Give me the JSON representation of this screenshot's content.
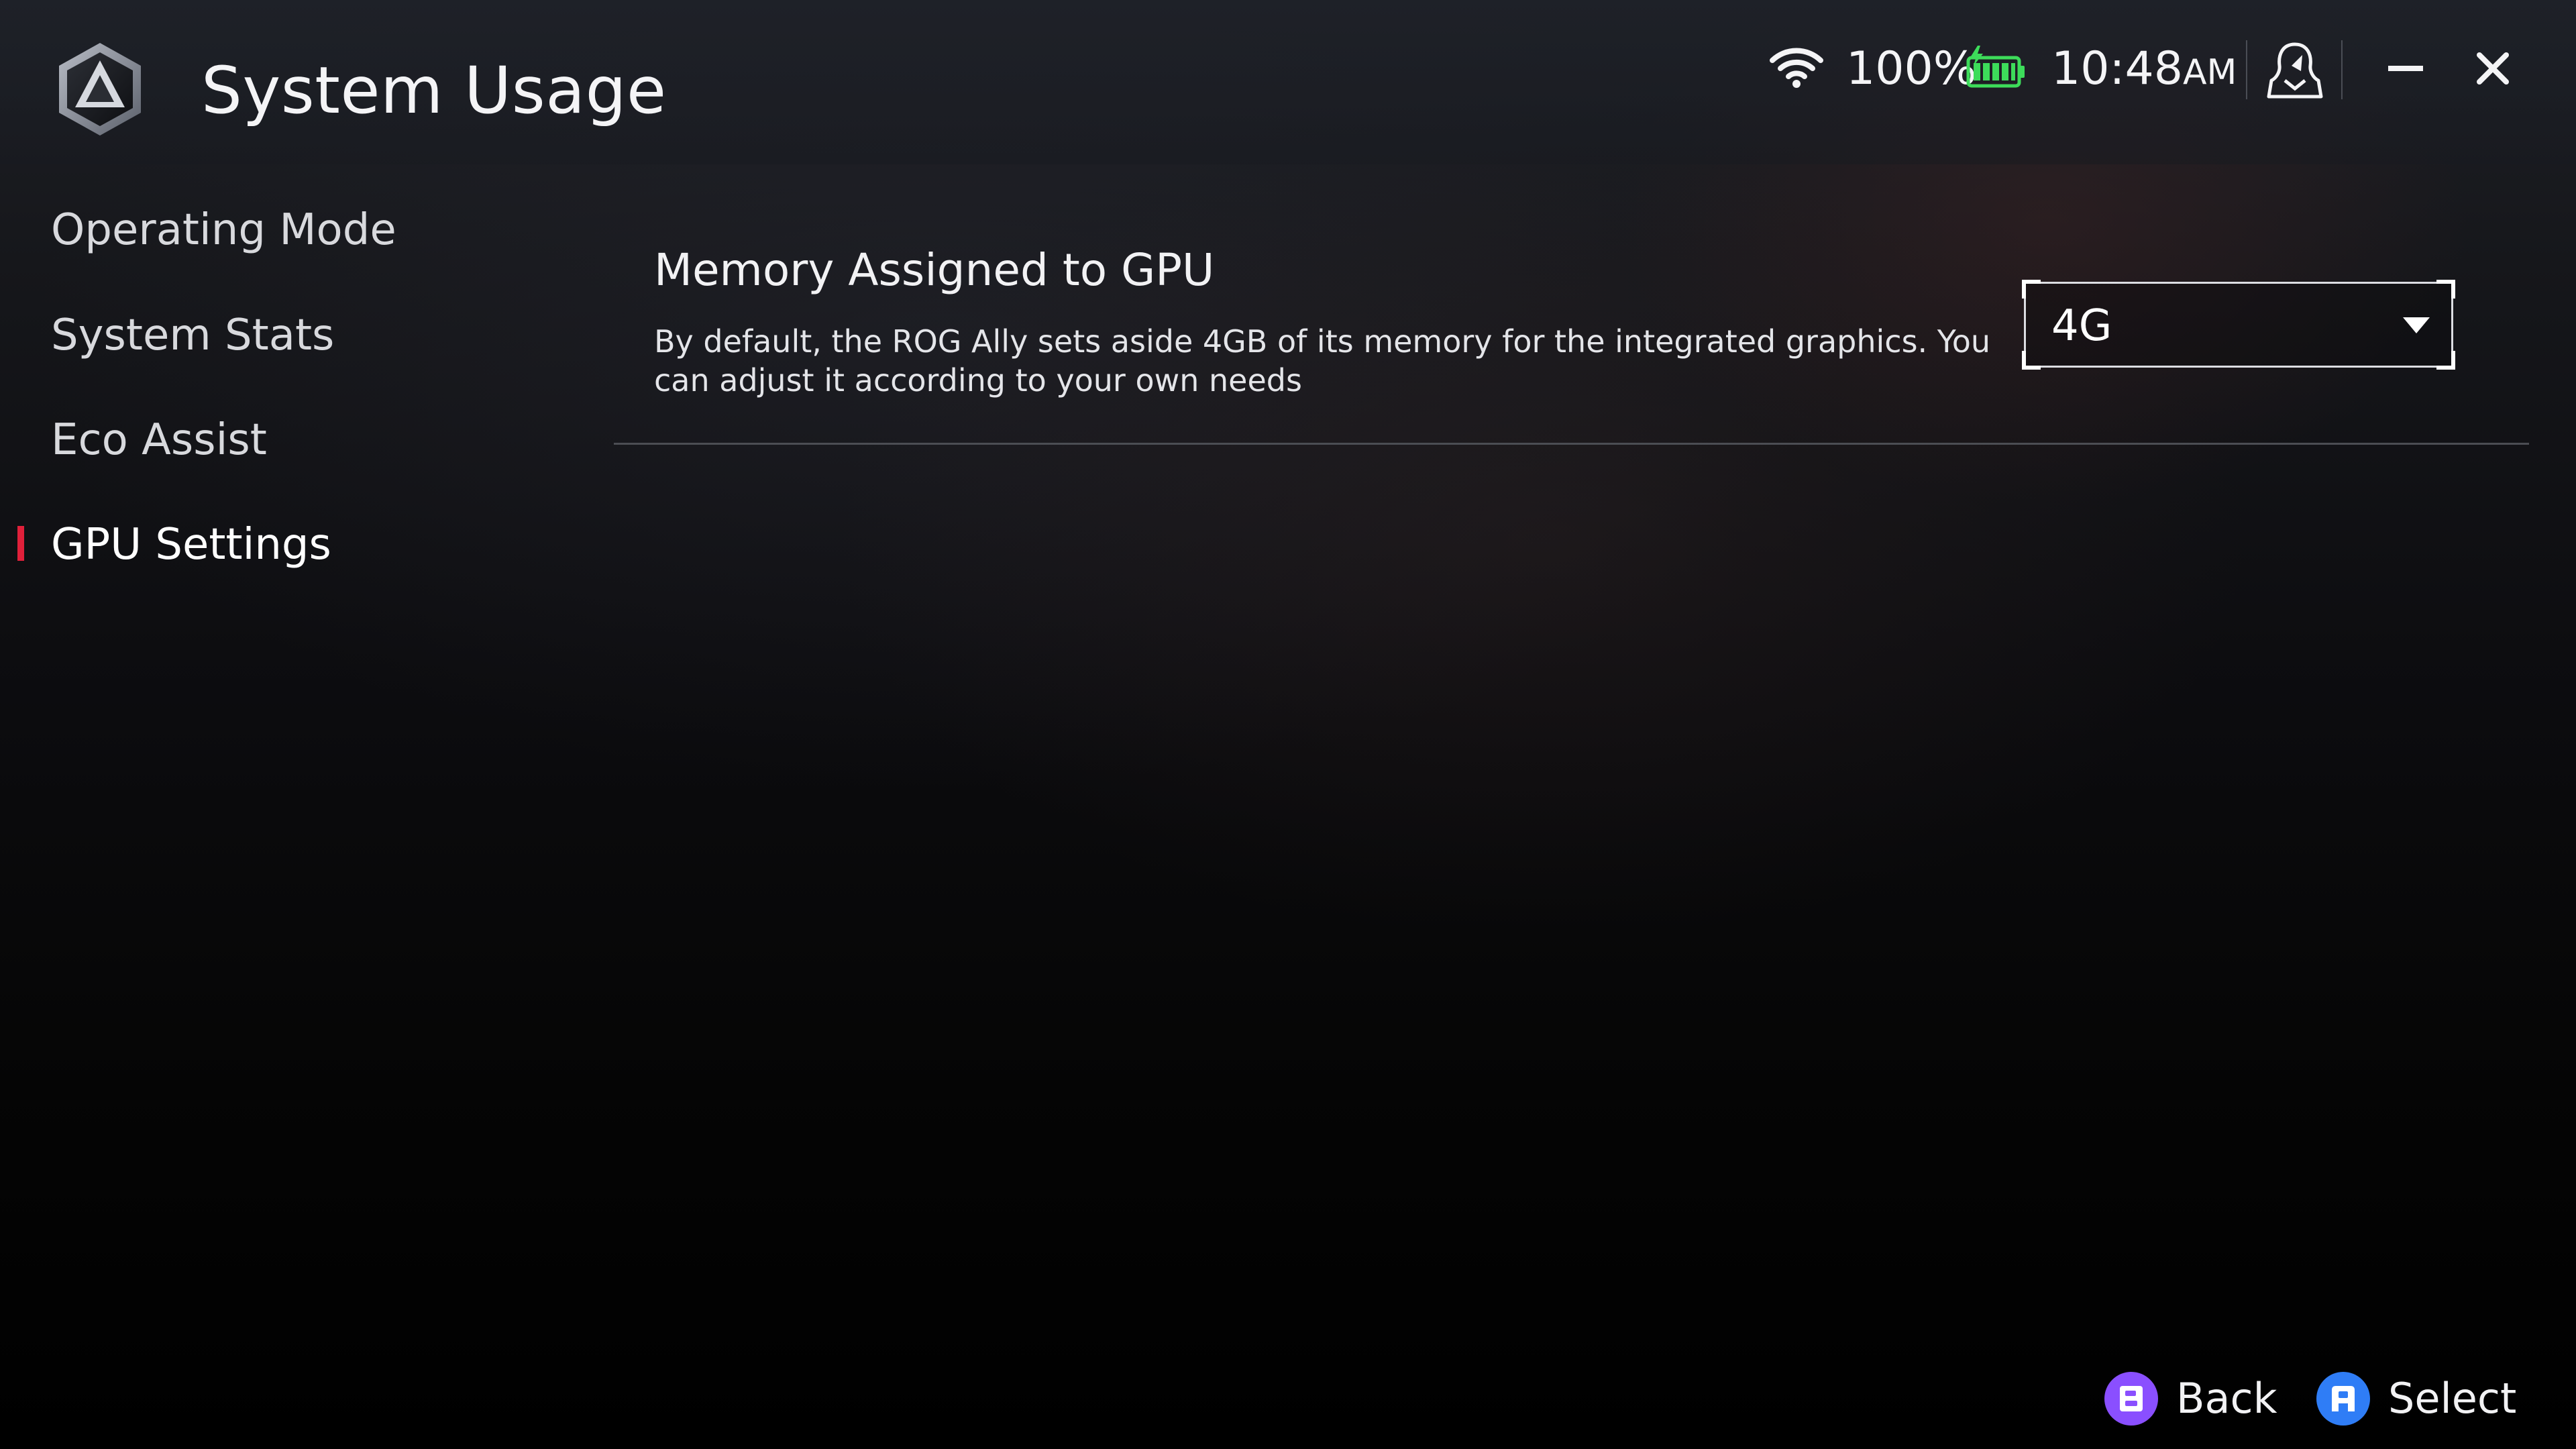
{
  "header": {
    "title": "System Usage",
    "logo_icon": "armoury-crate-logo-icon"
  },
  "status": {
    "wifi_icon": "wifi-icon",
    "battery_percent": "100%",
    "battery_icon": "battery-charging-icon",
    "time": "10:48",
    "ampm": "AM",
    "user_icon": "user-profile-icon"
  },
  "window_controls": {
    "minimize_icon": "minimize-icon",
    "close_icon": "close-icon"
  },
  "sidebar": {
    "items": [
      {
        "label": "Operating Mode",
        "active": false
      },
      {
        "label": "System Stats",
        "active": false
      },
      {
        "label": "Eco Assist",
        "active": false
      },
      {
        "label": "GPU Settings",
        "active": true
      }
    ]
  },
  "main": {
    "setting": {
      "title": "Memory Assigned to GPU",
      "description": "By default, the ROG Ally sets aside 4GB of its memory for the integrated graphics. You can adjust it according to your own needs",
      "selected_value": "4G"
    }
  },
  "footer": {
    "back": {
      "label": "Back",
      "glyph": "B",
      "color": "#8a4fff"
    },
    "select": {
      "label": "Select",
      "glyph": "A",
      "color": "#2f7df6"
    }
  },
  "colors": {
    "accent_active": "#e0203a",
    "battery_green": "#3ddc5a"
  }
}
